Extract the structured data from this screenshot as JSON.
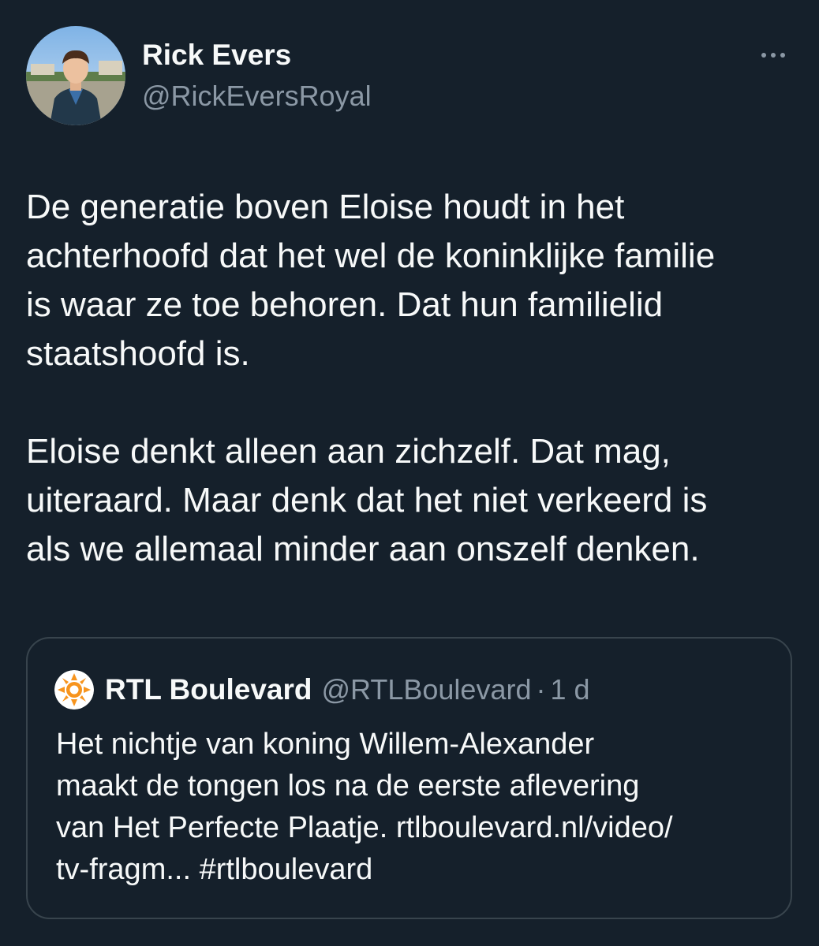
{
  "author": {
    "name": "Rick Evers",
    "handle": "@RickEversRoyal"
  },
  "tweet": {
    "paragraphs": [
      "De generatie boven Eloise houdt in het\nachterhoofd dat het wel de koninklijke familie\nis waar ze toe behoren. Dat hun familielid\nstaatshoofd is.",
      "Eloise denkt alleen aan zichzelf. Dat mag,\nuiteraard. Maar denk dat het niet verkeerd is\nals we allemaal minder aan onszelf denken."
    ]
  },
  "quote": {
    "name": "RTL Boulevard",
    "handle": "@RTLBoulevard",
    "separator": "·",
    "time": "1 d",
    "text": "Het nichtje van koning Willem-Alexander\nmaakt de tongen los na de eerste aflevering\nvan Het Perfecte Plaatje. rtlboulevard.nl/video/\ntv-fragm... #rtlboulevard"
  },
  "icons": {
    "more": "more-horizontal-icon",
    "quote_logo": "rtl-boulevard-logo"
  },
  "colors": {
    "background": "#15202b",
    "text_primary": "#f7f9f9",
    "text_secondary": "#8b98a5",
    "border": "#38444d",
    "logo_orange": "#f7941d"
  }
}
